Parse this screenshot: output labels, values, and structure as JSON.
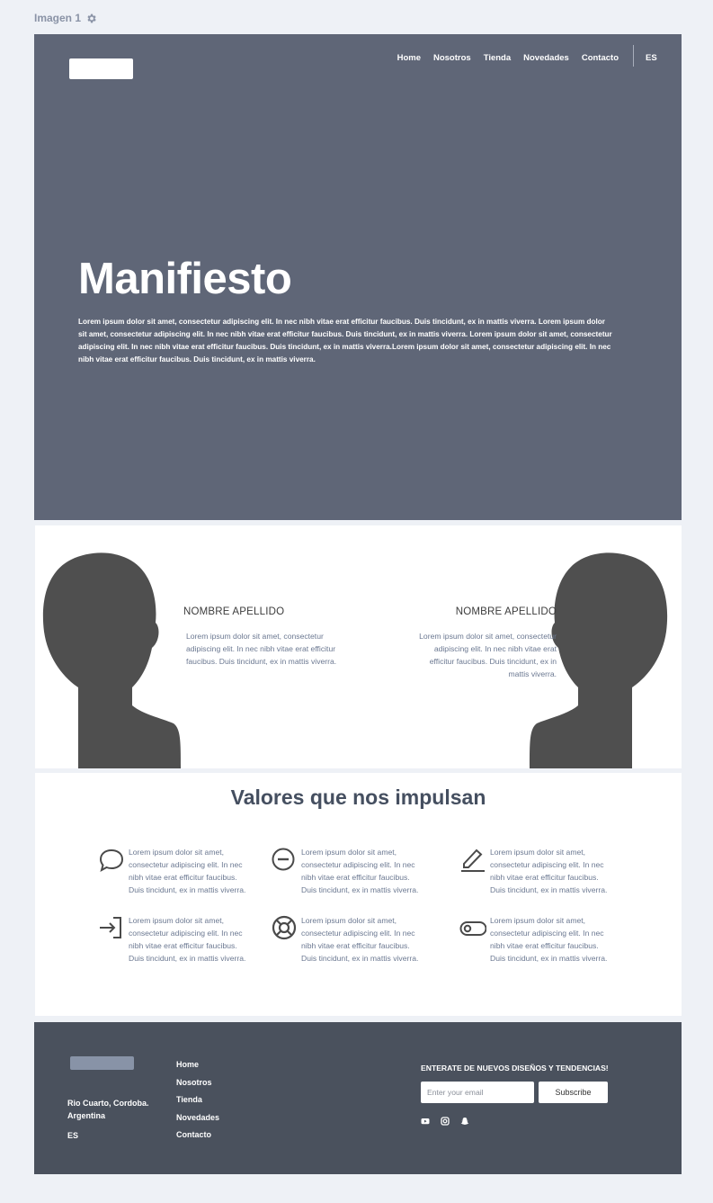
{
  "frame": {
    "label": "Imagen 1"
  },
  "hero": {
    "nav": [
      "Home",
      "Nosotros",
      "Tienda",
      "Novedades",
      "Contacto"
    ],
    "lang": "ES",
    "title": "Manifiesto",
    "text": "Lorem ipsum dolor sit amet, consectetur adipiscing elit. In nec nibh vitae erat efficitur faucibus. Duis tincidunt, ex in mattis viverra. Lorem ipsum dolor sit amet, consectetur adipiscing elit. In nec nibh vitae erat efficitur faucibus. Duis tincidunt, ex in mattis viverra. Lorem ipsum dolor sit amet, consectetur adipiscing elit. In nec nibh vitae erat efficitur faucibus. Duis tincidunt, ex in mattis viverra.Lorem ipsum dolor sit amet, consectetur adipiscing elit. In nec nibh vitae erat efficitur faucibus. Duis tincidunt, ex in mattis viverra."
  },
  "team": {
    "members": [
      {
        "name": "NOMBRE APELLIDO",
        "bio": "Lorem ipsum dolor sit amet, consectetur adipiscing elit. In nec nibh vitae erat efficitur faucibus. Duis tincidunt, ex in mattis viverra."
      },
      {
        "name": "NOMBRE APELLIDO",
        "bio": "Lorem ipsum dolor sit amet, consectetur adipiscing elit. In nec nibh vitae erat efficitur faucibus. Duis tincidunt, ex in mattis viverra."
      }
    ]
  },
  "values": {
    "title": "Valores que nos impulsan",
    "items": [
      {
        "icon": "chat-bubble-icon",
        "text": "Lorem ipsum dolor sit amet, consectetur adipiscing elit. In nec nibh vitae erat efficitur faucibus. Duis tincidunt, ex in mattis viverra."
      },
      {
        "icon": "minus-circle-icon",
        "text": "Lorem ipsum dolor sit amet, consectetur adipiscing elit. In nec nibh vitae erat efficitur faucibus. Duis tincidunt, ex in mattis viverra."
      },
      {
        "icon": "pencil-icon",
        "text": "Lorem ipsum dolor sit amet, consectetur adipiscing elit. In nec nibh vitae erat efficitur faucibus. Duis tincidunt, ex in mattis viverra."
      },
      {
        "icon": "sign-in-icon",
        "text": "Lorem ipsum dolor sit amet, consectetur adipiscing elit. In nec nibh vitae erat efficitur faucibus. Duis tincidunt, ex in mattis viverra."
      },
      {
        "icon": "life-ring-icon",
        "text": "Lorem ipsum dolor sit amet, consectetur adipiscing elit. In nec nibh vitae erat efficitur faucibus. Duis tincidunt, ex in mattis viverra."
      },
      {
        "icon": "toggle-icon",
        "text": "Lorem ipsum dolor sit amet, consectetur adipiscing elit. In nec nibh vitae erat efficitur faucibus. Duis tincidunt, ex in mattis viverra."
      }
    ]
  },
  "footer": {
    "address_line1": "Rio Cuarto, Cordoba.",
    "address_line2": "Argentina",
    "lang": "ES",
    "links": [
      "Home",
      "Nosotros",
      "Tienda",
      "Novedades",
      "Contacto"
    ],
    "newsletter_title": "ENTERATE DE NUEVOS DISEÑOS Y TENDENCIAS!",
    "email_placeholder": "Enter your email",
    "subscribe_label": "Subscribe",
    "social": [
      "youtube-icon",
      "instagram-icon",
      "snapchat-icon"
    ]
  },
  "colors": {
    "page_bg": "#eef1f6",
    "hero_bg": "#5f6677",
    "footer_bg": "#4a515d",
    "silhouette": "#4f4f4f",
    "body_text": "#6b7891",
    "heading": "#454f60"
  }
}
